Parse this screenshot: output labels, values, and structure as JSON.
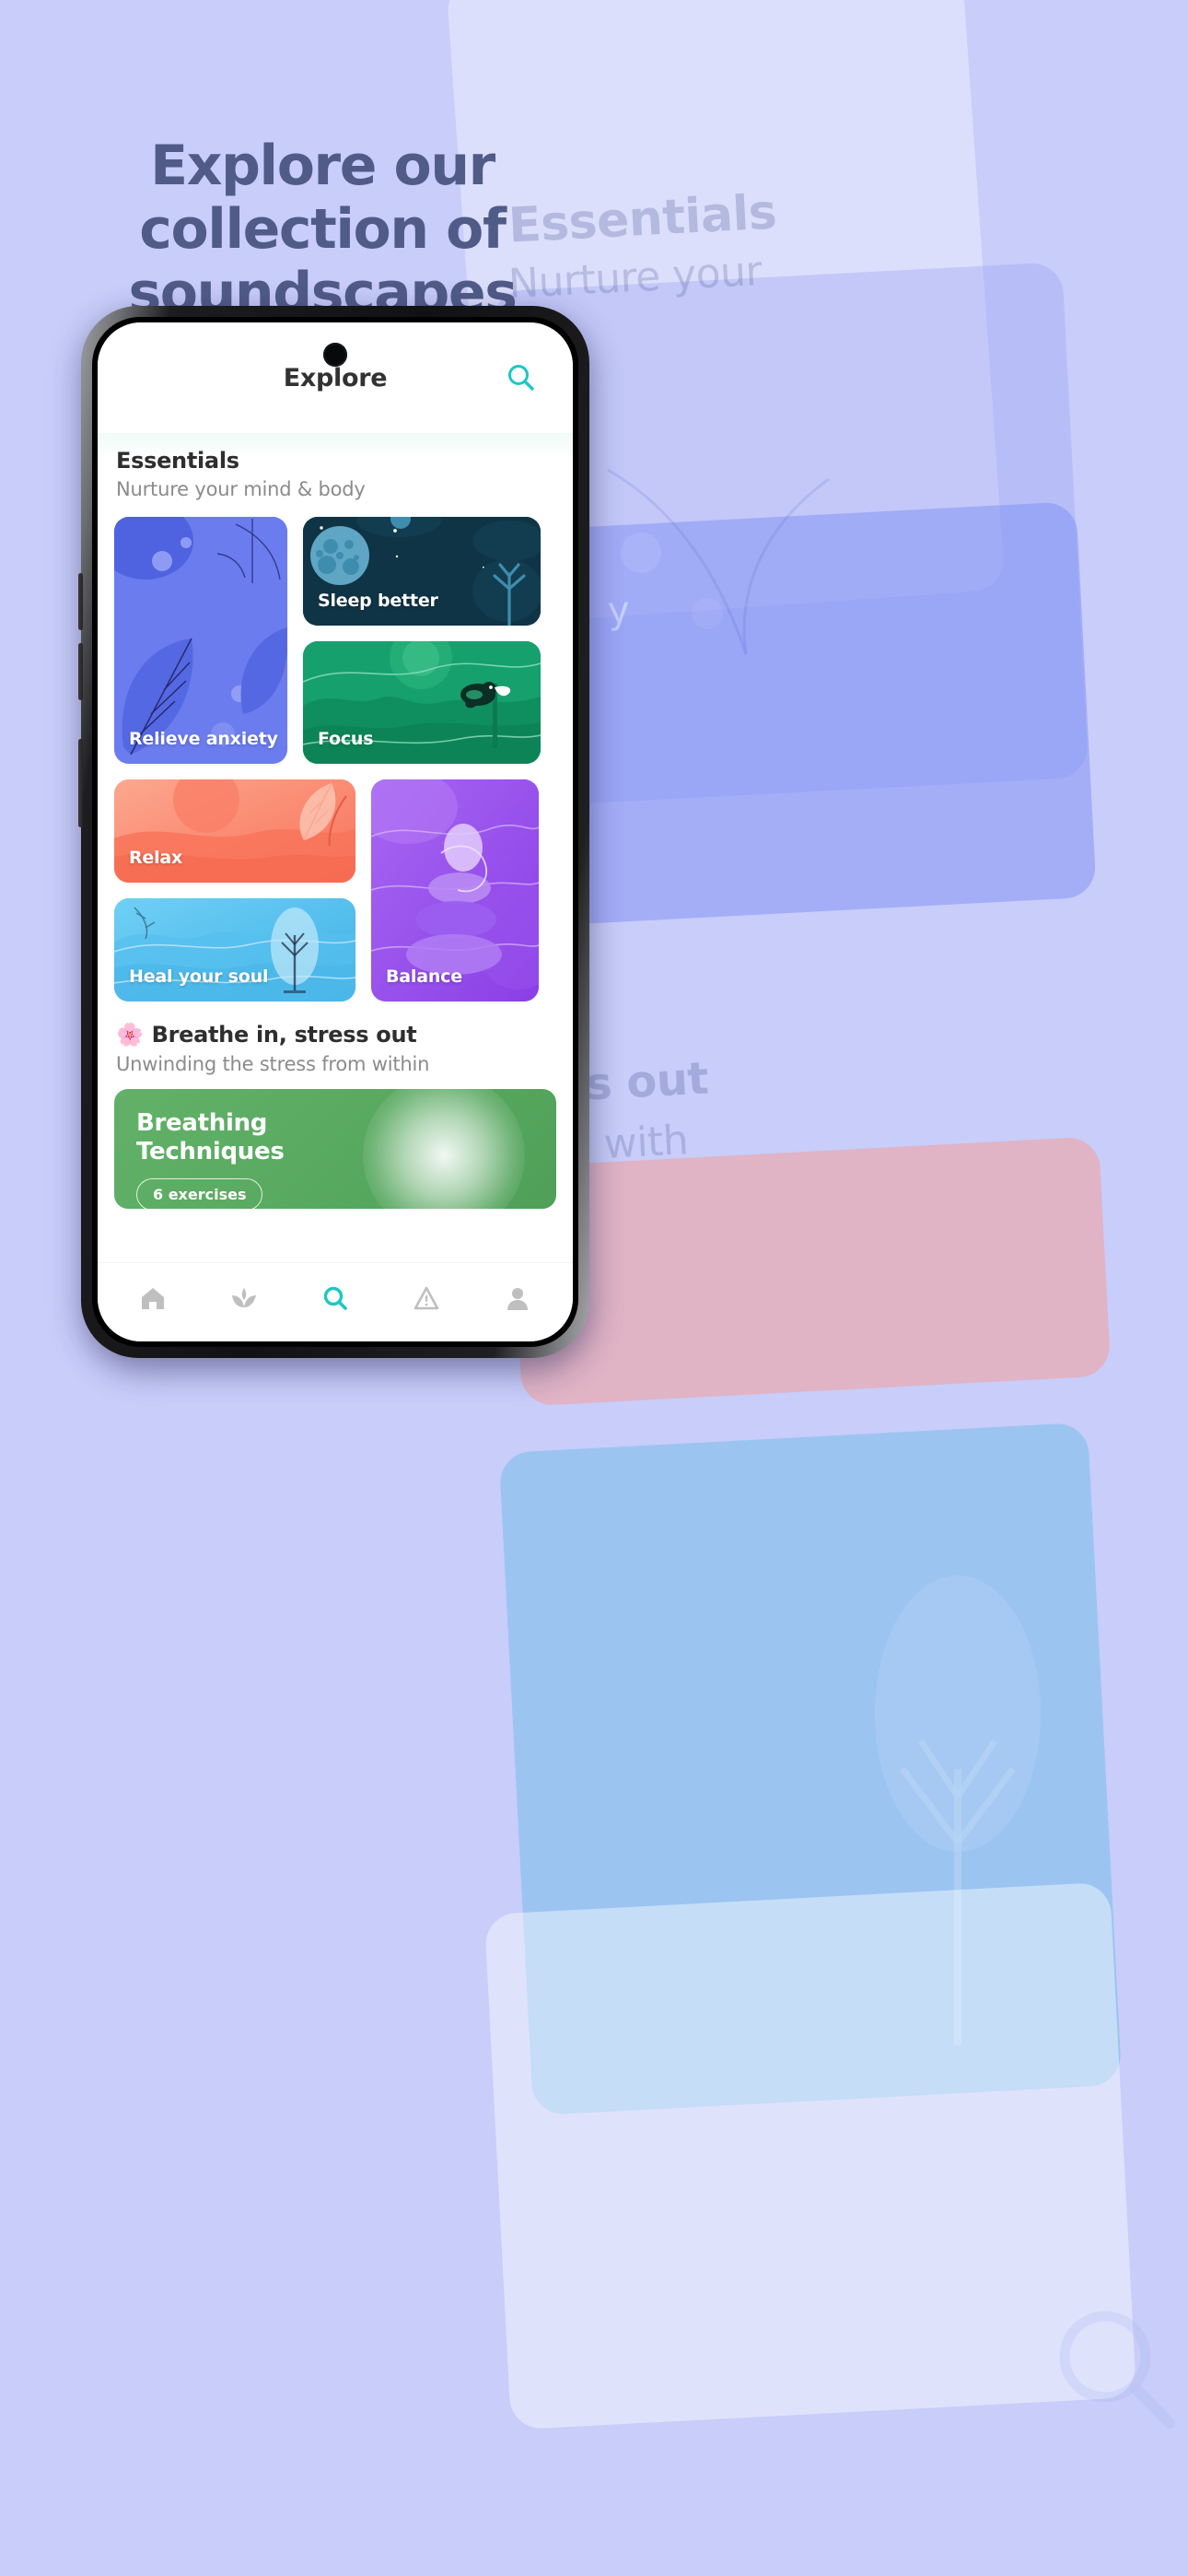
{
  "theme": {
    "page_background": "#C8CDF9",
    "headline_color": "#515B87",
    "accent_teal": "#1EC6C6",
    "card_colors": {
      "relieve_anxiety": "#6B7CEE",
      "sleep_better": "#0F3445",
      "focus": "#16A06E",
      "relax": "#F98D7D",
      "heal_your_soul": "#57C3F0",
      "balance": "#9B55EE",
      "breathing": "#5BAC63"
    }
  },
  "hero": {
    "headline": "Explore our collection of soundscapes"
  },
  "background_preview": {
    "essentials_title": "Essentials",
    "essentials_sub": "Nurture your",
    "fragment_y": "y",
    "stress_out": "s out",
    "from_within": "m with"
  },
  "app": {
    "header": {
      "title": "Explore",
      "search_icon": "search-icon"
    },
    "sections": [
      {
        "title": "Essentials",
        "subtitle": "Nurture your mind & body",
        "cards": [
          {
            "label": "Relieve anxiety",
            "color": "#6B7CEE"
          },
          {
            "label": "Sleep better",
            "color": "#0F3445"
          },
          {
            "label": "Focus",
            "color": "#16A06E"
          },
          {
            "label": "Relax",
            "color": "#F98D7D"
          },
          {
            "label": "Heal your soul",
            "color": "#57C3F0"
          },
          {
            "label": "Balance",
            "color": "#9B55EE"
          }
        ]
      },
      {
        "emoji": "🌸",
        "title": "Breathe in, stress out",
        "subtitle": "Unwinding the stress from within",
        "feature_card": {
          "title_line1": "Breathing",
          "title_line2": "Techniques",
          "badge": "6 exercises"
        }
      }
    ],
    "bottom_nav": [
      {
        "name": "home",
        "icon": "home-icon",
        "active": false
      },
      {
        "name": "grow",
        "icon": "leaf-icon",
        "active": false
      },
      {
        "name": "explore",
        "icon": "search-icon",
        "active": true
      },
      {
        "name": "insight",
        "icon": "triangle-icon",
        "active": false
      },
      {
        "name": "profile",
        "icon": "person-icon",
        "active": false
      }
    ]
  }
}
